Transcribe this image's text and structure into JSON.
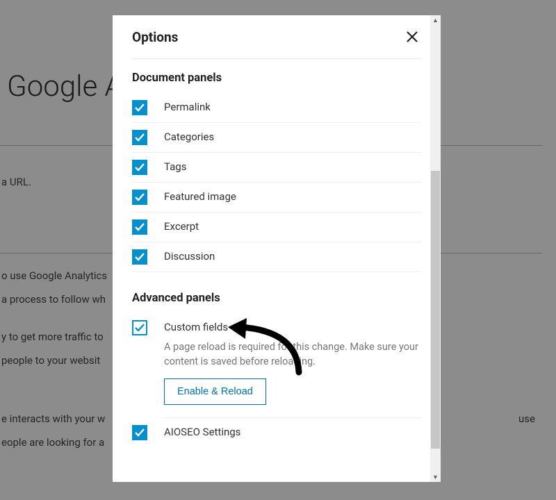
{
  "background": {
    "title_fragment": "Google A",
    "snippets": [
      "a URL.",
      "o use Google Analytics",
      "a process to follow wh",
      "y to get more traffic to",
      "people to your websit",
      "e interacts with your w",
      "eople are looking for a"
    ],
    "snippet_right1": "use"
  },
  "modal": {
    "title": "Options",
    "sections": [
      {
        "title": "Document panels",
        "items": [
          {
            "label": "Permalink",
            "checked": true,
            "style": "filled"
          },
          {
            "label": "Categories",
            "checked": true,
            "style": "filled"
          },
          {
            "label": "Tags",
            "checked": true,
            "style": "filled"
          },
          {
            "label": "Featured image",
            "checked": true,
            "style": "filled"
          },
          {
            "label": "Excerpt",
            "checked": true,
            "style": "filled"
          },
          {
            "label": "Discussion",
            "checked": true,
            "style": "filled"
          }
        ]
      },
      {
        "title": "Advanced panels",
        "items": [
          {
            "label": "Custom fields",
            "checked": true,
            "style": "outlined",
            "hint": "A page reload is required for this change. Make sure your content is saved before reloading.",
            "action_label": "Enable & Reload"
          },
          {
            "label": "AIOSEO Settings",
            "checked": true,
            "style": "filled"
          }
        ]
      }
    ]
  }
}
